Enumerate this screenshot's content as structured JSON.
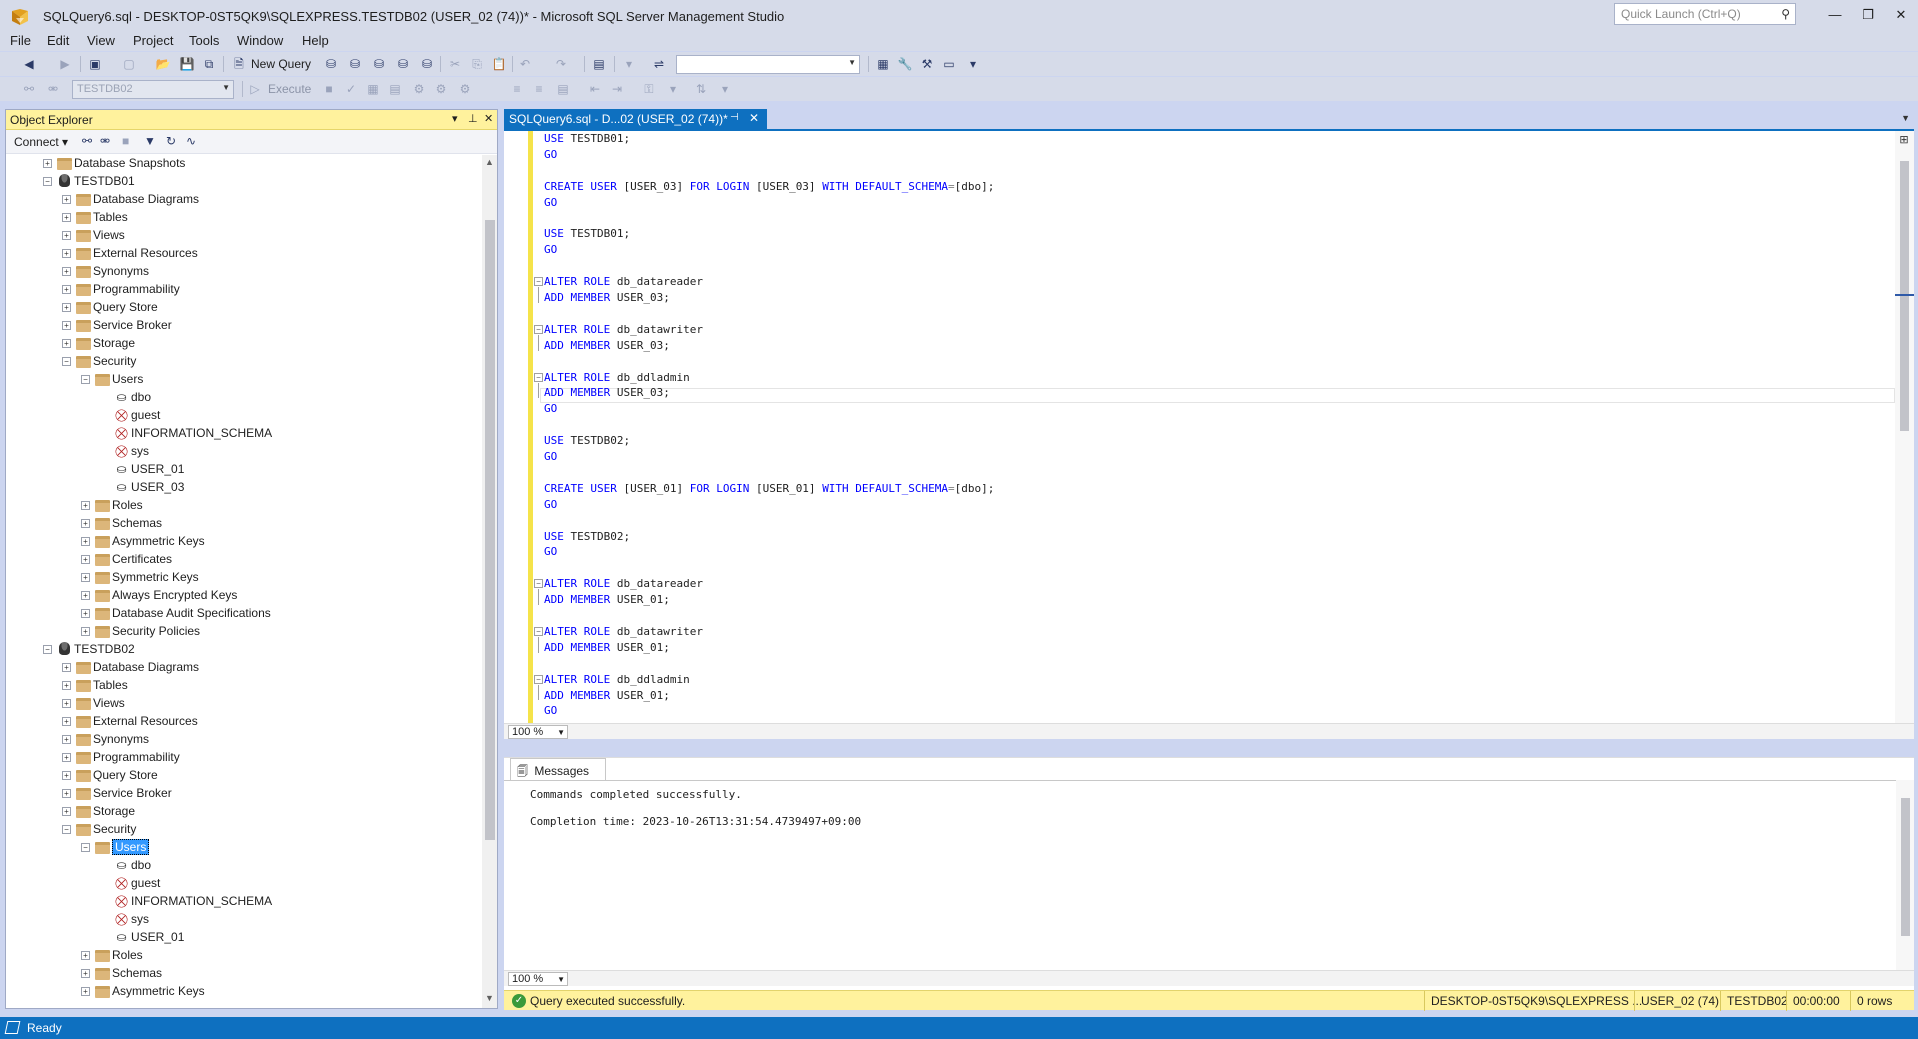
{
  "window": {
    "title": "SQLQuery6.sql - DESKTOP-0ST5QK9\\SQLEXPRESS.TESTDB02 (USER_02 (74))* - Microsoft SQL Server Management Studio",
    "quick_launch_placeholder": "Quick Launch (Ctrl+Q)",
    "minimize": "—",
    "restore": "❐",
    "close": "✕"
  },
  "menu": [
    "File",
    "Edit",
    "View",
    "Project",
    "Tools",
    "Window",
    "Help"
  ],
  "toolbar": {
    "new_query_label": "New Query",
    "database_combo": "TESTDB02",
    "execute_label": "Execute"
  },
  "object_explorer": {
    "title": "Object Explorer",
    "connect_label": "Connect",
    "tree": [
      {
        "label": "Database Snapshots",
        "level": 2,
        "expander": "+",
        "icon": "folder"
      },
      {
        "label": "TESTDB01",
        "level": 2,
        "expander": "-",
        "icon": "database"
      },
      {
        "label": "Database Diagrams",
        "level": 3,
        "expander": "+",
        "icon": "folder"
      },
      {
        "label": "Tables",
        "level": 3,
        "expander": "+",
        "icon": "folder"
      },
      {
        "label": "Views",
        "level": 3,
        "expander": "+",
        "icon": "folder"
      },
      {
        "label": "External Resources",
        "level": 3,
        "expander": "+",
        "icon": "folder"
      },
      {
        "label": "Synonyms",
        "level": 3,
        "expander": "+",
        "icon": "folder"
      },
      {
        "label": "Programmability",
        "level": 3,
        "expander": "+",
        "icon": "folder"
      },
      {
        "label": "Query Store",
        "level": 3,
        "expander": "+",
        "icon": "folder"
      },
      {
        "label": "Service Broker",
        "level": 3,
        "expander": "+",
        "icon": "folder"
      },
      {
        "label": "Storage",
        "level": 3,
        "expander": "+",
        "icon": "folder"
      },
      {
        "label": "Security",
        "level": 3,
        "expander": "-",
        "icon": "folder"
      },
      {
        "label": "Users",
        "level": 4,
        "expander": "-",
        "icon": "folder"
      },
      {
        "label": "dbo",
        "level": 5,
        "expander": "",
        "icon": "user"
      },
      {
        "label": "guest",
        "level": 5,
        "expander": "",
        "icon": "user-disabled"
      },
      {
        "label": "INFORMATION_SCHEMA",
        "level": 5,
        "expander": "",
        "icon": "user-disabled"
      },
      {
        "label": "sys",
        "level": 5,
        "expander": "",
        "icon": "user-disabled"
      },
      {
        "label": "USER_01",
        "level": 5,
        "expander": "",
        "icon": "user"
      },
      {
        "label": "USER_03",
        "level": 5,
        "expander": "",
        "icon": "user"
      },
      {
        "label": "Roles",
        "level": 4,
        "expander": "+",
        "icon": "folder"
      },
      {
        "label": "Schemas",
        "level": 4,
        "expander": "+",
        "icon": "folder"
      },
      {
        "label": "Asymmetric Keys",
        "level": 4,
        "expander": "+",
        "icon": "folder"
      },
      {
        "label": "Certificates",
        "level": 4,
        "expander": "+",
        "icon": "folder"
      },
      {
        "label": "Symmetric Keys",
        "level": 4,
        "expander": "+",
        "icon": "folder"
      },
      {
        "label": "Always Encrypted Keys",
        "level": 4,
        "expander": "+",
        "icon": "folder"
      },
      {
        "label": "Database Audit Specifications",
        "level": 4,
        "expander": "+",
        "icon": "folder"
      },
      {
        "label": "Security Policies",
        "level": 4,
        "expander": "+",
        "icon": "folder"
      },
      {
        "label": "TESTDB02",
        "level": 2,
        "expander": "-",
        "icon": "database"
      },
      {
        "label": "Database Diagrams",
        "level": 3,
        "expander": "+",
        "icon": "folder"
      },
      {
        "label": "Tables",
        "level": 3,
        "expander": "+",
        "icon": "folder"
      },
      {
        "label": "Views",
        "level": 3,
        "expander": "+",
        "icon": "folder"
      },
      {
        "label": "External Resources",
        "level": 3,
        "expander": "+",
        "icon": "folder"
      },
      {
        "label": "Synonyms",
        "level": 3,
        "expander": "+",
        "icon": "folder"
      },
      {
        "label": "Programmability",
        "level": 3,
        "expander": "+",
        "icon": "folder"
      },
      {
        "label": "Query Store",
        "level": 3,
        "expander": "+",
        "icon": "folder"
      },
      {
        "label": "Service Broker",
        "level": 3,
        "expander": "+",
        "icon": "folder"
      },
      {
        "label": "Storage",
        "level": 3,
        "expander": "+",
        "icon": "folder"
      },
      {
        "label": "Security",
        "level": 3,
        "expander": "-",
        "icon": "folder"
      },
      {
        "label": "Users",
        "level": 4,
        "expander": "-",
        "icon": "folder",
        "selected": true
      },
      {
        "label": "dbo",
        "level": 5,
        "expander": "",
        "icon": "user"
      },
      {
        "label": "guest",
        "level": 5,
        "expander": "",
        "icon": "user-disabled"
      },
      {
        "label": "INFORMATION_SCHEMA",
        "level": 5,
        "expander": "",
        "icon": "user-disabled"
      },
      {
        "label": "sys",
        "level": 5,
        "expander": "",
        "icon": "user-disabled"
      },
      {
        "label": "USER_01",
        "level": 5,
        "expander": "",
        "icon": "user"
      },
      {
        "label": "Roles",
        "level": 4,
        "expander": "+",
        "icon": "folder"
      },
      {
        "label": "Schemas",
        "level": 4,
        "expander": "+",
        "icon": "folder"
      },
      {
        "label": "Asymmetric Keys",
        "level": 4,
        "expander": "+",
        "icon": "folder"
      }
    ]
  },
  "editor": {
    "tab_label": "SQLQuery6.sql - D...02 (USER_02 (74))*",
    "zoom": "100 %",
    "lines": [
      [
        [
          "kw",
          "USE"
        ],
        [
          "",
          "TESTDB01;"
        ]
      ],
      [
        [
          "kw",
          "GO"
        ]
      ],
      [],
      [
        [
          "kw",
          "CREATE USER"
        ],
        [
          "",
          "[USER_03]"
        ],
        [
          "kw",
          "FOR LOGIN"
        ],
        [
          "",
          "[USER_03]"
        ],
        [
          "kw",
          "WITH DEFAULT_SCHEMA"
        ],
        [
          "gray",
          "="
        ],
        [
          "",
          "[dbo];"
        ]
      ],
      [
        [
          "kw",
          "GO"
        ]
      ],
      [],
      [
        [
          "kw",
          "USE"
        ],
        [
          "",
          "TESTDB01;"
        ]
      ],
      [
        [
          "kw",
          "GO"
        ]
      ],
      [],
      [
        [
          "kw",
          "ALTER ROLE"
        ],
        [
          "",
          "db_datareader"
        ]
      ],
      [
        [
          "kw",
          "ADD MEMBER"
        ],
        [
          "",
          "USER_03;"
        ]
      ],
      [],
      [
        [
          "kw",
          "ALTER ROLE"
        ],
        [
          "",
          "db_datawriter"
        ]
      ],
      [
        [
          "kw",
          "ADD MEMBER"
        ],
        [
          "",
          "USER_03;"
        ]
      ],
      [],
      [
        [
          "kw",
          "ALTER ROLE"
        ],
        [
          "",
          "db_ddladmin"
        ]
      ],
      [
        [
          "kw",
          "ADD MEMBER"
        ],
        [
          "",
          "USER_03;"
        ]
      ],
      [
        [
          "kw",
          "GO"
        ]
      ],
      [],
      [
        [
          "kw",
          "USE"
        ],
        [
          "",
          "TESTDB02;"
        ]
      ],
      [
        [
          "kw",
          "GO"
        ]
      ],
      [],
      [
        [
          "kw",
          "CREATE USER"
        ],
        [
          "",
          "[USER_01]"
        ],
        [
          "kw",
          "FOR LOGIN"
        ],
        [
          "",
          "[USER_01]"
        ],
        [
          "kw",
          "WITH DEFAULT_SCHEMA"
        ],
        [
          "gray",
          "="
        ],
        [
          "",
          "[dbo];"
        ]
      ],
      [
        [
          "kw",
          "GO"
        ]
      ],
      [],
      [
        [
          "kw",
          "USE"
        ],
        [
          "",
          "TESTDB02;"
        ]
      ],
      [
        [
          "kw",
          "GO"
        ]
      ],
      [],
      [
        [
          "kw",
          "ALTER ROLE"
        ],
        [
          "",
          "db_datareader"
        ]
      ],
      [
        [
          "kw",
          "ADD MEMBER"
        ],
        [
          "",
          "USER_01;"
        ]
      ],
      [],
      [
        [
          "kw",
          "ALTER ROLE"
        ],
        [
          "",
          "db_datawriter"
        ]
      ],
      [
        [
          "kw",
          "ADD MEMBER"
        ],
        [
          "",
          "USER_01;"
        ]
      ],
      [],
      [
        [
          "kw",
          "ALTER ROLE"
        ],
        [
          "",
          "db_ddladmin"
        ]
      ],
      [
        [
          "kw",
          "ADD MEMBER"
        ],
        [
          "",
          "USER_01;"
        ]
      ],
      [
        [
          "kw",
          "GO"
        ]
      ]
    ]
  },
  "results": {
    "tab_label": "Messages",
    "messages": [
      "Commands completed successfully.",
      "",
      "Completion time: 2023-10-26T13:31:54.4739497+09:00"
    ],
    "zoom": "100 %"
  },
  "query_status": {
    "message": "Query executed successfully.",
    "server": "DESKTOP-0ST5QK9\\SQLEXPRESS ...",
    "user": "USER_02 (74)",
    "database": "TESTDB02",
    "elapsed": "00:00:00",
    "rows": "0 rows"
  },
  "statusbar": {
    "text": "Ready"
  },
  "colors": {
    "accent": "#0e70c0",
    "object_explorer_header": "#fff29d",
    "keyword": "#0000ff"
  }
}
